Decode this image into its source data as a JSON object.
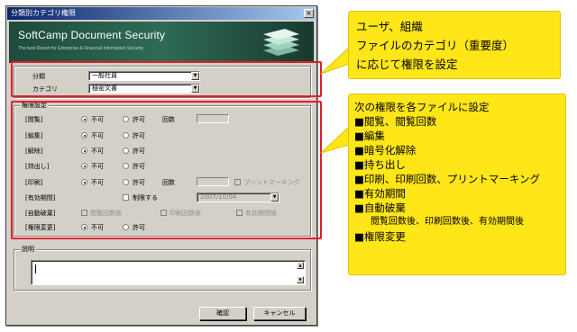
{
  "dialog": {
    "title": "分類別カテゴリ権限",
    "close_label": "×",
    "banner_title": "SoftCamp Document Security",
    "banner_subtitle": "The best Resort for Enterprise & Financial Information Security"
  },
  "classification": {
    "fields": [
      {
        "label": "分類",
        "value": "一般社員"
      },
      {
        "label": "カテゴリ",
        "value": "極密文書"
      }
    ]
  },
  "permissions": {
    "legend": "権限設定",
    "rows": [
      {
        "label": "[閲覧]",
        "opt1": "不可",
        "opt2": "許可",
        "extra": "回数"
      },
      {
        "label": "[編集]",
        "opt1": "不可",
        "opt2": "許可"
      },
      {
        "label": "[解除]",
        "opt1": "不可",
        "opt2": "許可"
      },
      {
        "label": "[持出し]",
        "opt1": "不可",
        "opt2": "許可"
      },
      {
        "label": "[印刷]",
        "opt1": "不可",
        "opt2": "許可",
        "extra": "回数",
        "check": "プリントマーキング"
      },
      {
        "label": "[有効期間]",
        "check_label": "制限する",
        "date": "2007/10/04"
      },
      {
        "label": "[自動破棄]",
        "c1": "閲覧回数後",
        "c2": "印刷回数後",
        "c3": "有効期間後"
      },
      {
        "label": "[権限変更]",
        "opt1": "不可",
        "opt2": "許可"
      }
    ]
  },
  "memo": {
    "legend": "説明",
    "value": ""
  },
  "buttons": {
    "ok": "確認",
    "cancel": "キャンセル"
  },
  "callouts": {
    "top": [
      "ユーザ、組織",
      "ファイルのカテゴリ（重要度）",
      "に応じて権限を設定"
    ],
    "right": [
      "次の権限を各ファイルに設定",
      "■閲覧、閲覧回数",
      "■編集",
      "■暗号化解除",
      "■持ち出し",
      "■印刷、印刷回数、プリントマーキング",
      "■有効期間",
      "■自動破棄",
      "閲覧回数後、印刷回数後、有効期間後",
      "■権限変更"
    ]
  },
  "colors": {
    "highlight": "#e0202a",
    "callout": "#ffe619",
    "banner": "#2f6b57"
  }
}
